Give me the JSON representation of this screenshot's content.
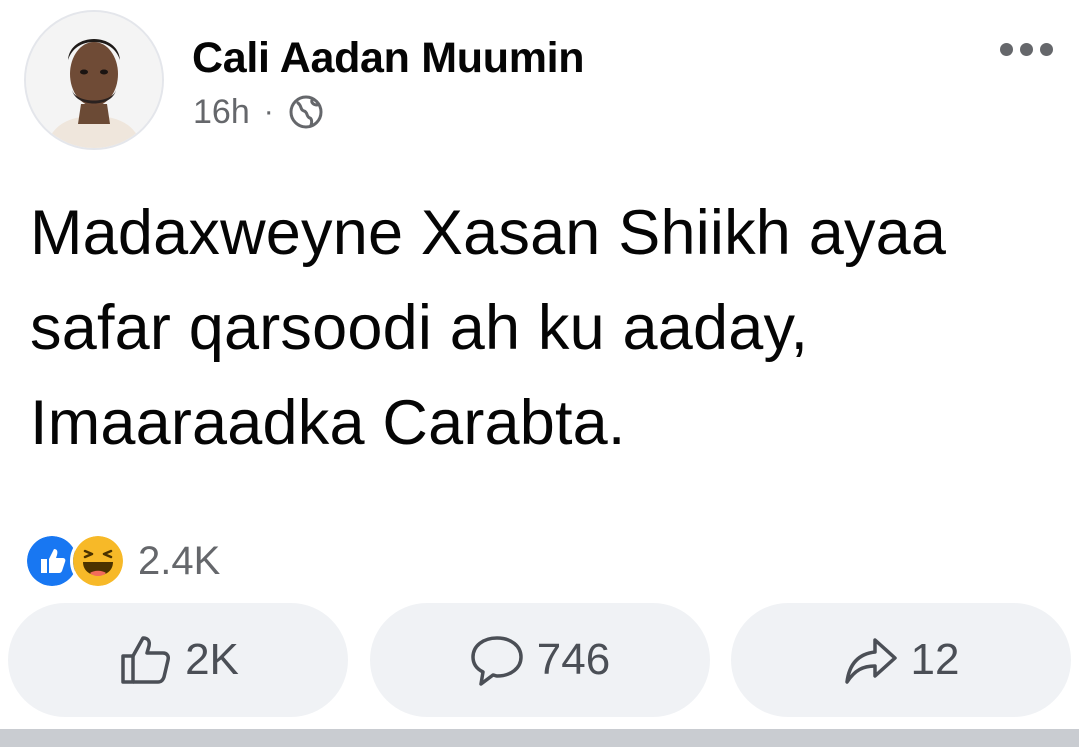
{
  "post": {
    "author": "Cali Aadan Muumin",
    "time": "16h",
    "separator": "·",
    "privacy_icon": "globe-icon",
    "text": "Madaxweyne Xasan Shiikh ayaa safar qarsoodi ah ku aaday, Imaaraadka Carabta."
  },
  "reactions": {
    "icons": [
      "like-reaction-icon",
      "haha-reaction-icon"
    ],
    "count": "2.4K"
  },
  "actions": {
    "like": {
      "count": "2K",
      "icon": "thumbs-up-icon"
    },
    "comment": {
      "count": "746",
      "icon": "comment-icon"
    },
    "share": {
      "count": "12",
      "icon": "share-icon"
    }
  },
  "colors": {
    "like_blue": "#1877f2",
    "haha_yellow": "#f7b928",
    "secondary_text": "#65676b",
    "button_bg": "#f0f2f5"
  }
}
